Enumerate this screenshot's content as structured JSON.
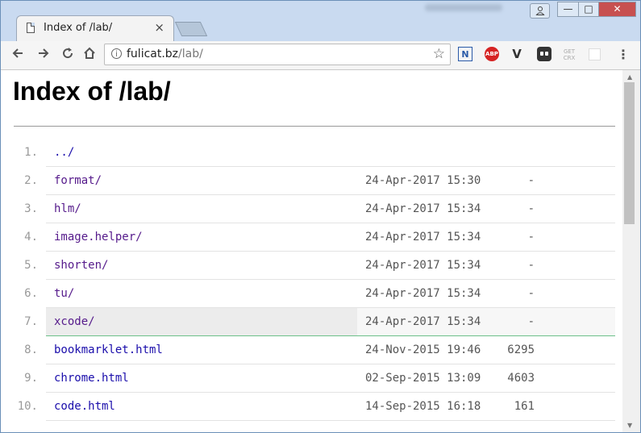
{
  "browser": {
    "tab_title": "Index of /lab/",
    "tab_close": "×",
    "url_domain": "fulicat.bz",
    "url_path": "/lab/",
    "star_icon": "☆",
    "window_controls": {
      "minimize": "—",
      "maximize": "□",
      "close": "✕"
    },
    "extensions": {
      "n": "N",
      "abp": "ABP",
      "v": "V",
      "crx_line1": "GET",
      "crx_line2": "CRX"
    },
    "menu": "⋮"
  },
  "page": {
    "heading": "Index of /lab/",
    "rows": [
      {
        "num": "1.",
        "name": "../",
        "date": "",
        "size": ""
      },
      {
        "num": "2.",
        "name": "format/",
        "date": "24-Apr-2017 15:30",
        "size": "-"
      },
      {
        "num": "3.",
        "name": "hlm/",
        "date": "24-Apr-2017 15:34",
        "size": "-"
      },
      {
        "num": "4.",
        "name": "image.helper/",
        "date": "24-Apr-2017 15:34",
        "size": "-"
      },
      {
        "num": "5.",
        "name": "shorten/",
        "date": "24-Apr-2017 15:34",
        "size": "-"
      },
      {
        "num": "6.",
        "name": "tu/",
        "date": "24-Apr-2017 15:34",
        "size": "-"
      },
      {
        "num": "7.",
        "name": "xcode/",
        "date": "24-Apr-2017 15:34",
        "size": "-",
        "highlighted": true
      },
      {
        "num": "8.",
        "name": "bookmarklet.html",
        "date": "24-Nov-2015 19:46",
        "size": "6295"
      },
      {
        "num": "9.",
        "name": "chrome.html",
        "date": "02-Sep-2015 13:09",
        "size": "4603"
      },
      {
        "num": "10.",
        "name": "code.html",
        "date": "14-Sep-2015 16:18",
        "size": "161"
      }
    ]
  },
  "colors": {
    "link": "#1a0dab",
    "visited_link": "#551a8b",
    "highlight_border": "#6cc08a"
  }
}
